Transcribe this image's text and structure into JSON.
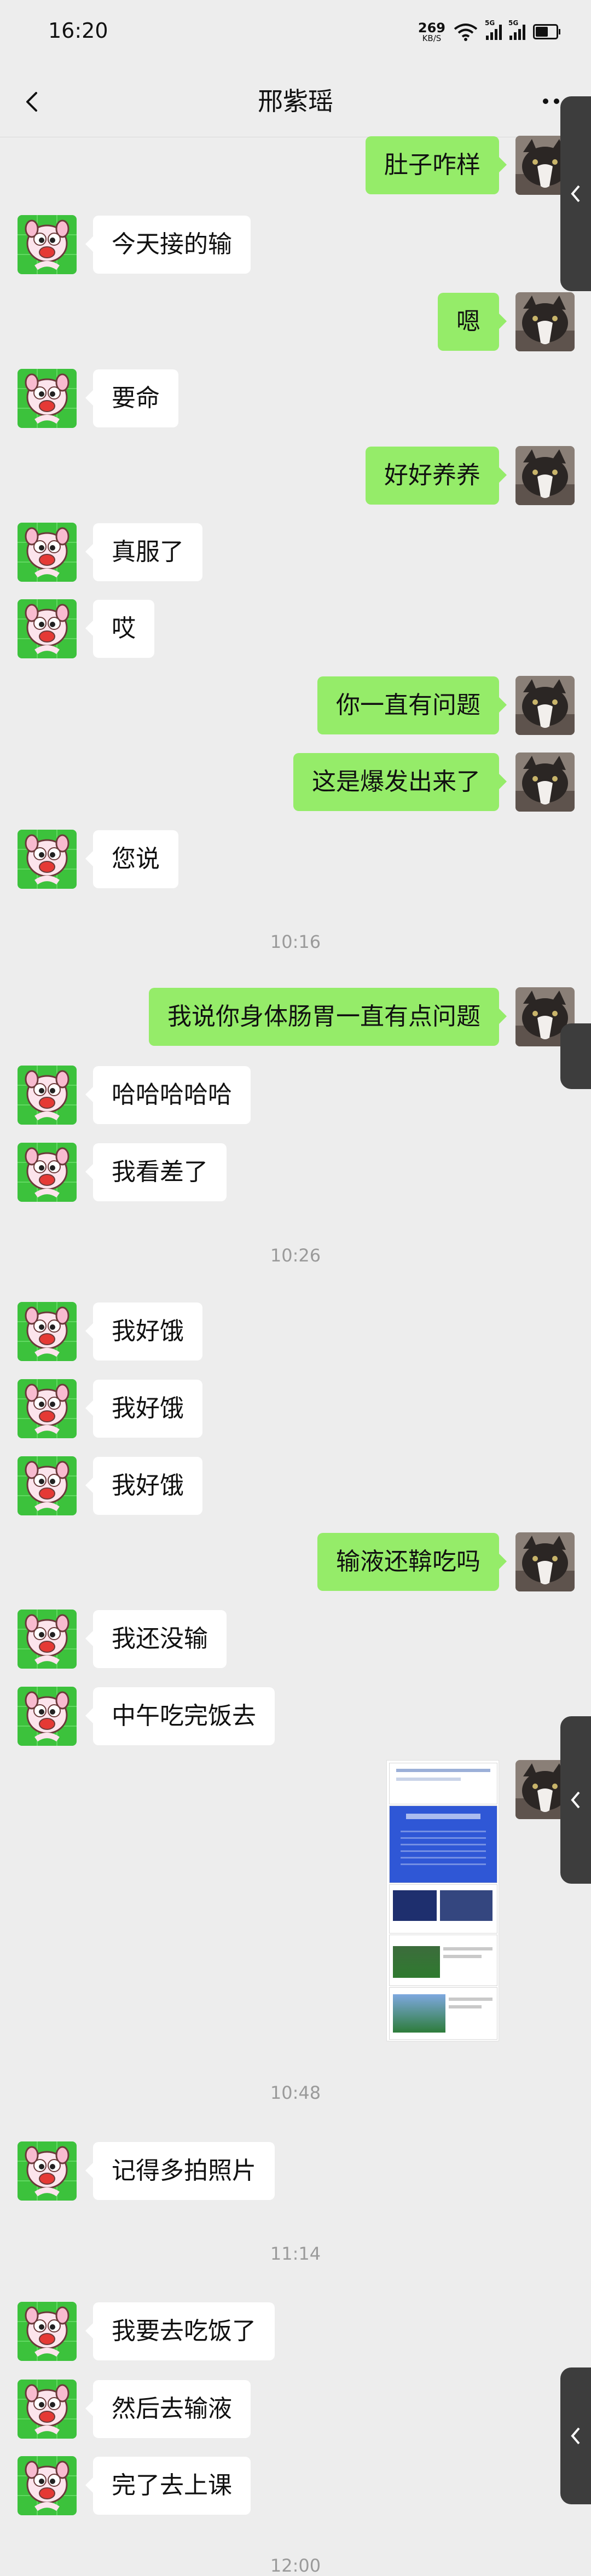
{
  "status_bar": {
    "time": "16:20",
    "net_speed": "269",
    "net_unit": "KB/S",
    "sim1": "5G",
    "sim2": "5G"
  },
  "header": {
    "title": "邢紫瑶"
  },
  "colors": {
    "sent_bubble": "#95ec69",
    "received_bubble": "#ffffff",
    "background": "#ededed"
  },
  "messages": [
    {
      "from": "me",
      "text": "肚子咋样"
    },
    {
      "from": "them",
      "text": "今天接的输"
    },
    {
      "from": "me",
      "text": "嗯"
    },
    {
      "from": "them",
      "text": "要命"
    },
    {
      "from": "me",
      "text": "好好养养"
    },
    {
      "from": "them",
      "text": "真服了"
    },
    {
      "from": "them",
      "text": "哎"
    },
    {
      "from": "me",
      "text": "你一直有问题"
    },
    {
      "from": "me",
      "text": "这是爆发出来了"
    },
    {
      "from": "them",
      "text": "您说"
    },
    {
      "time": "10:16"
    },
    {
      "from": "me",
      "text": "我说你身体肠胃一直有点问题"
    },
    {
      "from": "them",
      "text": "哈哈哈哈哈"
    },
    {
      "from": "them",
      "text": "我看差了"
    },
    {
      "time": "10:26"
    },
    {
      "from": "them",
      "text": "我好饿"
    },
    {
      "from": "them",
      "text": "我好饿"
    },
    {
      "from": "them",
      "text": "我好饿"
    },
    {
      "from": "me",
      "text": "输液还鞥吃吗"
    },
    {
      "from": "them",
      "text": "我还没输"
    },
    {
      "from": "them",
      "text": "中午吃完饭去"
    },
    {
      "from": "me",
      "type": "image"
    },
    {
      "time": "10:48"
    },
    {
      "from": "them",
      "text": "记得多拍照片"
    },
    {
      "time": "11:14"
    },
    {
      "from": "them",
      "text": "我要去吃饭了"
    },
    {
      "from": "them",
      "text": "然后去输液"
    },
    {
      "from": "them",
      "text": "完了去上课"
    },
    {
      "time": "12:00"
    }
  ]
}
